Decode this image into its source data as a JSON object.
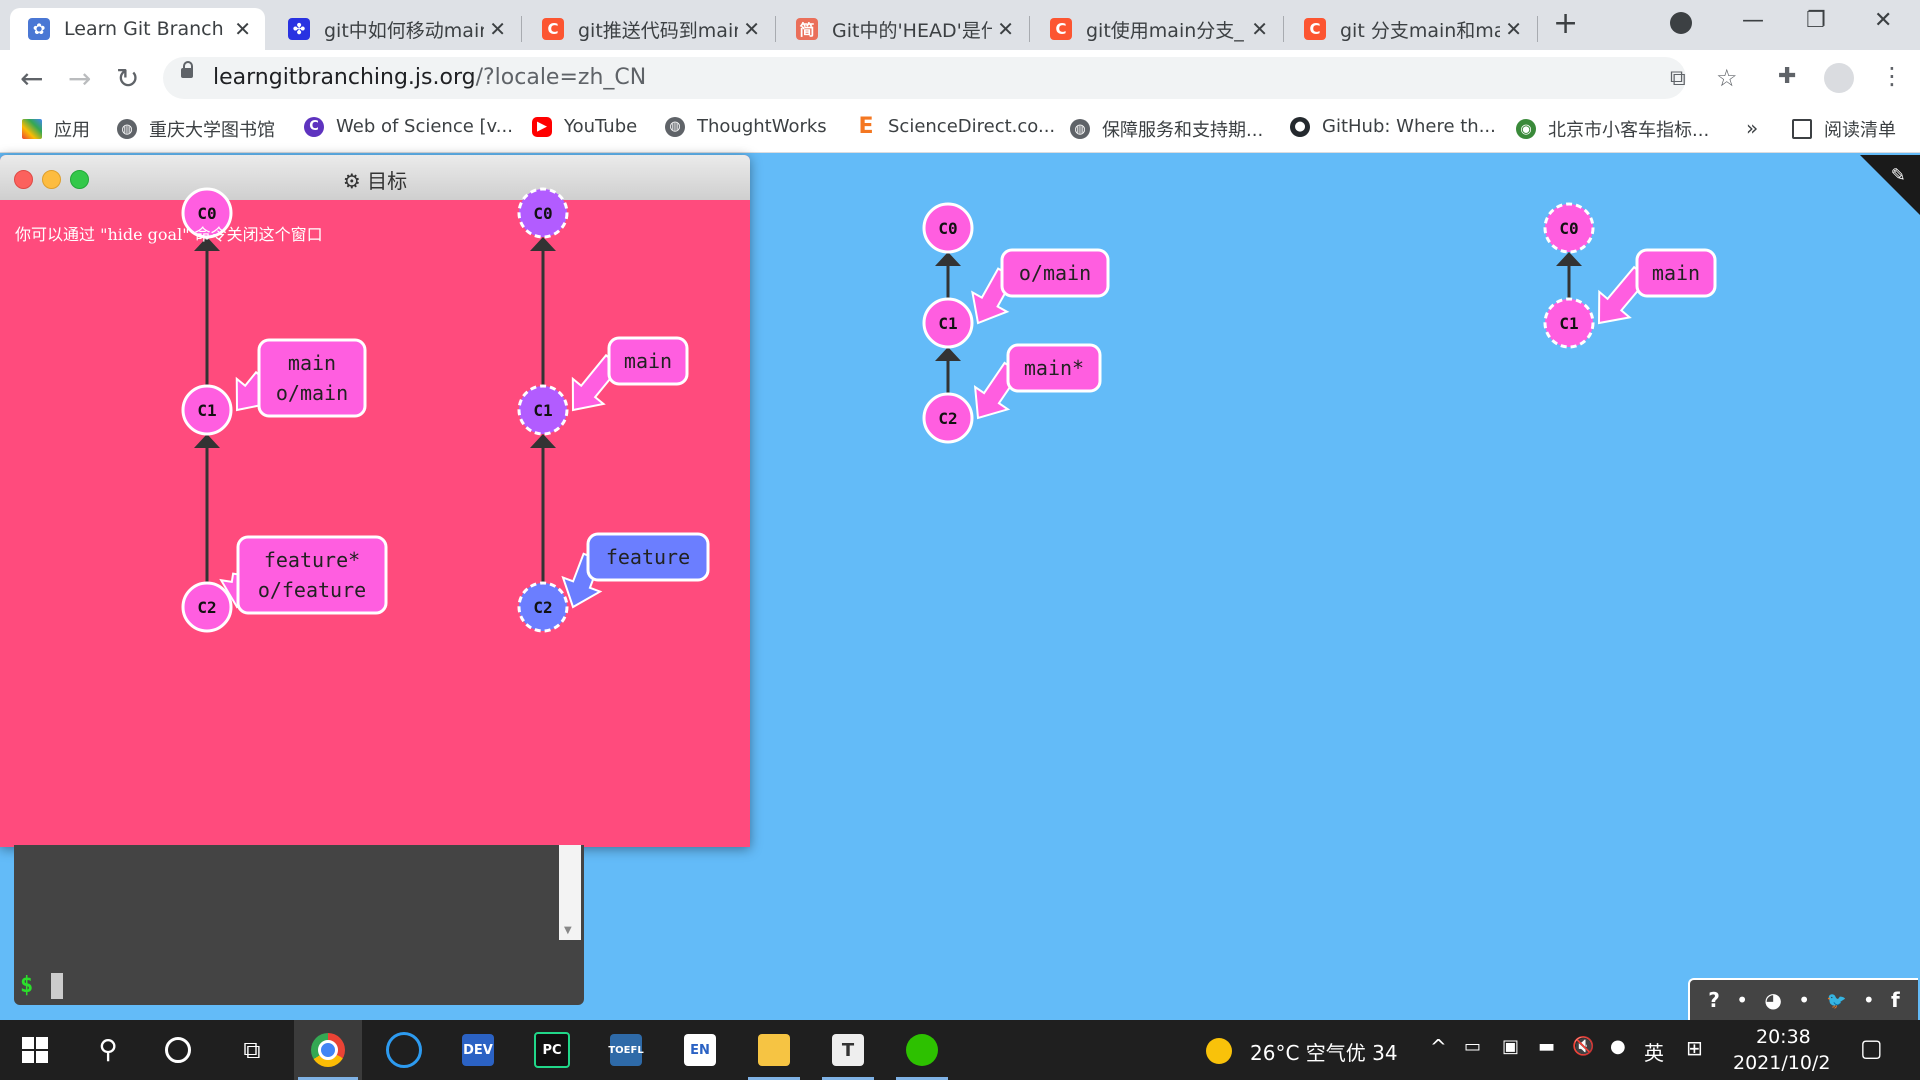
{
  "browser": {
    "tabs": [
      {
        "title": "Learn Git Branchin",
        "icon_color": "#4a77d4",
        "icon_glyph": "✿",
        "active": true
      },
      {
        "title": "git中如何移动main",
        "icon_color": "#2932e1",
        "icon_glyph": "✤",
        "active": false
      },
      {
        "title": "git推送代码到main",
        "icon_color": "#fc5531",
        "icon_glyph": "C",
        "active": false
      },
      {
        "title": "Git中的'HEAD'是什",
        "icon_color": "#ea6f5a",
        "icon_glyph": "简",
        "active": false
      },
      {
        "title": "git使用main分支_",
        "icon_color": "#fc5531",
        "icon_glyph": "C",
        "active": false
      },
      {
        "title": "git 分支main和ma",
        "icon_color": "#fc5531",
        "icon_glyph": "C",
        "active": false
      }
    ],
    "new_tab": "+",
    "url_host": "learngitbranching.js.org",
    "url_path": "/?locale=zh_CN",
    "bookmarks": [
      {
        "label": "应用",
        "icon_color": "#4285f4"
      },
      {
        "label": "重庆大学图书馆",
        "icon_color": "#5f6368"
      },
      {
        "label": "Web of Science [v...",
        "icon_color": "#5e33bf"
      },
      {
        "label": "YouTube",
        "icon_color": "#ff0000"
      },
      {
        "label": "ThoughtWorks",
        "icon_color": "#5f6368"
      },
      {
        "label": "ScienceDirect.co...",
        "icon_color": "#f47721"
      },
      {
        "label": "保障服务和支持期...",
        "icon_color": "#5f6368"
      },
      {
        "label": "GitHub: Where th...",
        "icon_color": "#24292e"
      },
      {
        "label": "北京市小客车指标...",
        "icon_color": "#3a8a3a"
      }
    ],
    "bookmarks_more": "»",
    "reading_list": "阅读清单"
  },
  "goal_window": {
    "title": "目标",
    "hint": "你可以通过 \"hide goal\" 命令关闭这个窗口"
  },
  "colors": {
    "background": "#63bbf8",
    "goal_bg": "#ff4b7d",
    "commit_pink": "#ff5ee0",
    "commit_purple": "#b25cff",
    "commit_blue": "#6b7eff",
    "branch_pink": "#ff5ee0",
    "branch_blue": "#6b7eff"
  },
  "graphs": {
    "goal_local": {
      "commits": [
        {
          "id": "C0",
          "label": "C0",
          "color": "commit_pink",
          "dashed": false
        },
        {
          "id": "C1",
          "label": "C1",
          "color": "commit_pink",
          "dashed": false
        },
        {
          "id": "C2",
          "label": "C2",
          "color": "commit_pink",
          "dashed": false
        }
      ],
      "branches": [
        {
          "target": "C1",
          "lines": [
            "main",
            "o/main"
          ],
          "color": "branch_pink"
        },
        {
          "target": "C2",
          "lines": [
            "feature*",
            "o/feature"
          ],
          "color": "branch_pink"
        }
      ]
    },
    "goal_remote": {
      "commits": [
        {
          "id": "C0",
          "label": "C0",
          "color": "commit_purple",
          "dashed": true
        },
        {
          "id": "C1",
          "label": "C1",
          "color": "commit_purple",
          "dashed": true
        },
        {
          "id": "C2",
          "label": "C2",
          "color": "commit_blue",
          "dashed": true
        }
      ],
      "branches": [
        {
          "target": "C1",
          "lines": [
            "main"
          ],
          "color": "branch_pink"
        },
        {
          "target": "C2",
          "lines": [
            "feature"
          ],
          "color": "branch_blue"
        }
      ]
    },
    "main_local": {
      "commits": [
        {
          "id": "C0",
          "label": "C0",
          "color": "commit_pink",
          "dashed": false
        },
        {
          "id": "C1",
          "label": "C1",
          "color": "commit_pink",
          "dashed": false
        },
        {
          "id": "C2",
          "label": "C2",
          "color": "commit_pink",
          "dashed": false
        }
      ],
      "branches": [
        {
          "target": "C1",
          "lines": [
            "o/main"
          ],
          "color": "branch_pink"
        },
        {
          "target": "C2",
          "lines": [
            "main*"
          ],
          "color": "branch_pink"
        }
      ]
    },
    "main_remote": {
      "commits": [
        {
          "id": "C0",
          "label": "C0",
          "color": "commit_pink",
          "dashed": true
        },
        {
          "id": "C1",
          "label": "C1",
          "color": "commit_pink",
          "dashed": true
        }
      ],
      "branches": [
        {
          "target": "C1",
          "lines": [
            "main"
          ],
          "color": "branch_pink"
        }
      ]
    }
  },
  "terminal": {
    "prompt": "$"
  },
  "helper_bar": {
    "help": "?",
    "globe": "◕",
    "twitter": "🐦",
    "facebook": "f",
    "dot": "•"
  },
  "taskbar": {
    "weather": "26°C 空气优 34",
    "ime": "英",
    "time": "20:38",
    "date": "2021/10/2"
  }
}
